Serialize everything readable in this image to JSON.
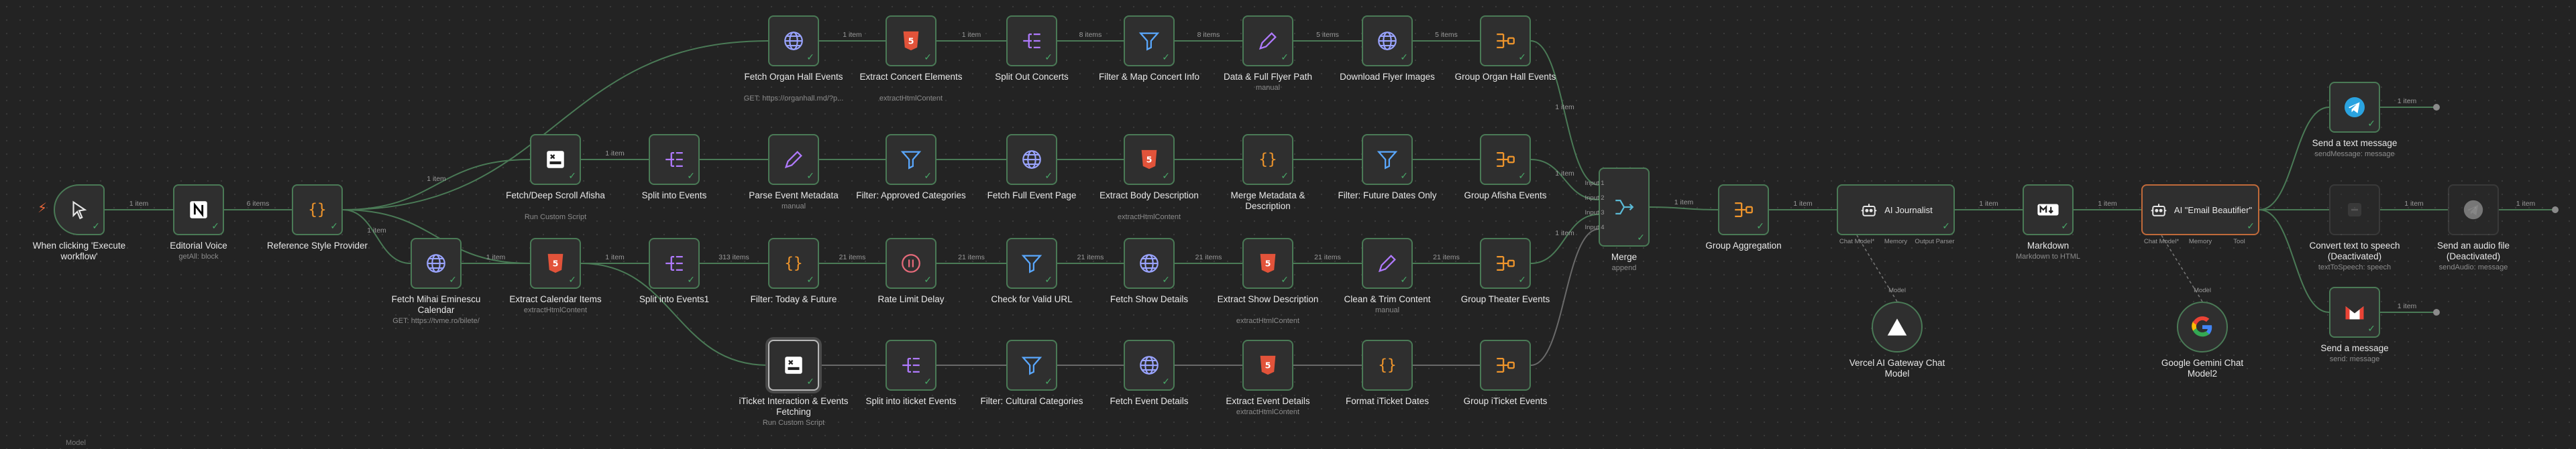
{
  "colors": {
    "success": "#48a868",
    "edge": "#4a7a56",
    "ai": "#c06a3a",
    "canvas": "#232323",
    "node": "#2f2f2f"
  },
  "trigger": {
    "label": "When clicking 'Execute workflow'",
    "icon": "cursor-pointer-icon"
  },
  "nodes": {
    "editorial": {
      "label": "Editorial Voice",
      "sub": "getAll: block",
      "icon": "notion-icon"
    },
    "reference": {
      "label": "Reference Style Provider",
      "sub": "",
      "icon": "code-braces-icon"
    },
    "fetchDeep": {
      "label": "Fetch/Deep Scroll Afisha",
      "sub": "Run Custom Script",
      "icon": "scrape-icon"
    },
    "fetchMihai": {
      "label": "Fetch Mihai Eminescu Calendar",
      "sub": "GET: https://tvme.ro/bilete/",
      "icon": "globe-icon"
    },
    "fetchOrgan": {
      "label": "Fetch Organ Hall Events",
      "sub": "GET: https://organhall.md/?p...",
      "icon": "globe-icon"
    },
    "extractConcert": {
      "label": "Extract Concert Elements",
      "sub": "extractHtmlContent",
      "icon": "html-icon"
    },
    "splitConcerts": {
      "label": "Split Out Concerts",
      "sub": "",
      "icon": "split-icon"
    },
    "filterMap": {
      "label": "Filter & Map Concert Info",
      "sub": "",
      "icon": "filter-icon"
    },
    "dataFlyer": {
      "label": "Data & Full Flyer Path",
      "sub": "manual",
      "icon": "pencil-icon"
    },
    "downloadFlyer": {
      "label": "Download Flyer Images",
      "sub": "",
      "icon": "globe-icon"
    },
    "groupOrgan": {
      "label": "Group Organ Hall Events",
      "sub": "",
      "icon": "aggregate-icon"
    },
    "splitEvents": {
      "label": "Split into Events",
      "sub": "",
      "icon": "split-icon"
    },
    "parseMeta": {
      "label": "Parse Event Metadata",
      "sub": "manual",
      "icon": "pencil-icon"
    },
    "filterApproved": {
      "label": "Filter: Approved Categories",
      "sub": "",
      "icon": "filter-icon"
    },
    "fetchFull": {
      "label": "Fetch Full Event Page",
      "sub": "",
      "icon": "globe-icon"
    },
    "extractBody": {
      "label": "Extract Body Description",
      "sub": "extractHtmlContent",
      "icon": "html-icon"
    },
    "mergeMeta": {
      "label": "Merge Metadata & Description",
      "sub": "",
      "icon": "code-braces-icon"
    },
    "filterFuture": {
      "label": "Filter: Future Dates Only",
      "sub": "",
      "icon": "filter-icon"
    },
    "groupAfisha": {
      "label": "Group Afisha Events",
      "sub": "",
      "icon": "aggregate-icon"
    },
    "extractCal": {
      "label": "Extract Calendar Items",
      "sub": "extractHtmlContent",
      "icon": "html-icon"
    },
    "splitEvents1": {
      "label": "Split into Events1",
      "sub": "",
      "icon": "split-icon"
    },
    "filterToday": {
      "label": "Filter: Today & Future",
      "sub": "",
      "icon": "code-braces-icon"
    },
    "rateLimit": {
      "label": "Rate Limit Delay",
      "sub": "",
      "icon": "pause-icon"
    },
    "checkURL": {
      "label": "Check for Valid URL",
      "sub": "",
      "icon": "filter-icon"
    },
    "fetchShow": {
      "label": "Fetch Show Details",
      "sub": "",
      "icon": "globe-icon"
    },
    "extractShow": {
      "label": "Extract Show Description",
      "sub": "extractHtmlContent",
      "icon": "html-icon"
    },
    "cleanTrim": {
      "label": "Clean & Trim Content",
      "sub": "manual",
      "icon": "pencil-icon"
    },
    "groupTheater": {
      "label": "Group Theater Events",
      "sub": "",
      "icon": "aggregate-icon"
    },
    "iticket": {
      "label": "iTicket Interaction & Events Fetching",
      "sub": "Run Custom Script",
      "icon": "scrape-icon"
    },
    "splitIticket": {
      "label": "Split into iticket Events",
      "sub": "",
      "icon": "split-icon"
    },
    "filterCultural": {
      "label": "Filter: Cultural Categories",
      "sub": "",
      "icon": "filter-icon"
    },
    "fetchEvent": {
      "label": "Fetch Event Details",
      "sub": "",
      "icon": "globe-icon"
    },
    "extractEvent": {
      "label": "Extract Event Details",
      "sub": "extractHtmlContent",
      "icon": "html-icon"
    },
    "formatIticket": {
      "label": "Format iTicket Dates",
      "sub": "",
      "icon": "code-braces-icon"
    },
    "groupIticket": {
      "label": "Group iTicket Events",
      "sub": "",
      "icon": "aggregate-icon"
    },
    "merge": {
      "label": "Merge",
      "sub": "append",
      "icon": "merge-icon",
      "inputs": [
        "Input 1",
        "Input 2",
        "Input 3",
        "Input 4"
      ]
    },
    "groupAgg": {
      "label": "Group Aggregation",
      "sub": "",
      "icon": "aggregate-icon"
    },
    "markdown": {
      "label": "Markdown",
      "sub": "Markdown to HTML",
      "icon": "markdown-icon"
    },
    "sendText": {
      "label": "Send a text message",
      "sub": "sendMessage: message",
      "icon": "telegram-icon"
    },
    "convertTTS": {
      "label": "Convert text to speech (Deactivated)",
      "sub": "textToSpeech: speech",
      "icon": "speech-icon"
    },
    "sendAudio": {
      "label": "Send an audio file (Deactivated)",
      "sub": "sendAudio: message",
      "icon": "audio-icon"
    },
    "sendMessage": {
      "label": "Send a message",
      "sub": "send: message",
      "icon": "gmail-icon"
    }
  },
  "agents": {
    "journalist": {
      "label": "AI Journalist",
      "icon": "robot-icon",
      "ports": [
        "Chat Model*",
        "Memory",
        "Output Parser"
      ]
    },
    "beautifier": {
      "label": "AI \"Email Beautifier\"",
      "icon": "robot-icon",
      "ports": [
        "Chat Model*",
        "Memory",
        "Tool"
      ]
    }
  },
  "models": {
    "vercel": {
      "label": "Vercel AI Gateway Chat Model",
      "port": "Model",
      "icon": "vercel-triangle-icon"
    },
    "gemini": {
      "label": "Google Gemini Chat Model2",
      "port": "Model",
      "icon": "google-icon"
    }
  },
  "edge_labels": {
    "trig": "1 item",
    "edit": "6 items",
    "r1": "1 item",
    "r2": "1 item",
    "fo1": "1 item",
    "fo2": "1 item",
    "fo3": "8 items",
    "fo4": "8 items",
    "fo5": "5 items",
    "fo6": "5 items",
    "se1": "1 item",
    "se3": "8 items",
    "fm1": "1 item",
    "fm2": "1 item",
    "fm3": "313 items",
    "fm4": "21 items",
    "fm5": "21 items",
    "fm6": "21 items",
    "fm7": "21 items",
    "fm8": "21 items",
    "fm9": "21 items",
    "go": "1 item",
    "ga": "1 item",
    "gt": "1 item",
    "m1": "1 item",
    "m2": "1 item",
    "m3": "1 item",
    "m4": "1 item",
    "s1": "1 item",
    "s2": "1 item",
    "s3": "1 item",
    "s4": "1 item",
    "s5": "1 item"
  },
  "footer": "Model"
}
